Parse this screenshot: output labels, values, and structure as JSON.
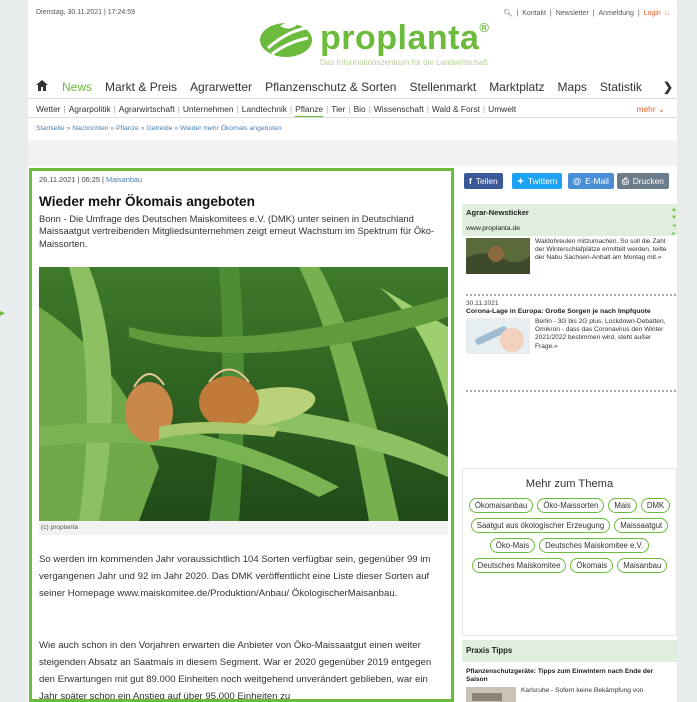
{
  "topbar": {
    "datetime": "Dienstag, 30.11.2021 | 17:24:59",
    "search_icon": "search-icon",
    "links": [
      "Kontakt",
      "Newsletter",
      "Anmeldung"
    ],
    "separator": "|",
    "login": "Login"
  },
  "logo": {
    "name": "proplanta",
    "reg": "®",
    "tagline": "Das Informationszentrum für die Landwirtschaft"
  },
  "mainnav": {
    "items": [
      "News",
      "Markt & Preis",
      "Agrarwetter",
      "Pflanzenschutz & Sorten",
      "Stellenmarkt",
      "Marktplatz",
      "Maps",
      "Statistik"
    ],
    "next": "❯"
  },
  "subnav": {
    "items": [
      "Wetter",
      "Agrarpolitik",
      "Agrarwirtschaft",
      "Unternehmen",
      "Landtechnik",
      "Pflanze",
      "Tier",
      "Bio",
      "Wissenschaft",
      "Wald & Forst",
      "Umwelt"
    ],
    "more": "mehr"
  },
  "breadcrumb": "Startseite » Nachrichten » Pflanze » Getreide » Wieder mehr Ökomais angeboten",
  "article": {
    "date": "26.11.2021 | 06:25 |",
    "category": "Maisanbau",
    "title": "Wieder mehr Ökomais angeboten",
    "lead": "Bonn - Die Umfrage des Deutschen Maiskomitees e.V. (DMK) unter seinen in Deutschland Maissaatgut vertreibenden Mitgliedsunternehmen zeigt erneut Wachstum im Spektrum für Öko-Maissorten.",
    "caption": "(c) proplanta",
    "paragraph1": "So werden im kommenden Jahr voraussichtlich 104 Sorten verfügbar sein, gegenüber 99 im vergangenen Jahr und 92 im Jahr 2020. Das DMK veröffentlicht eine Liste dieser Sorten auf seiner Homepage www.maiskomitee.de/Produktion/Anbau/ ÖkologischerMaisanbau.",
    "paragraph2": "Wie auch schon in den Vorjahren erwarten die Anbieter von Öko-Maissaatgut einen weiter steigenden Absatz an Saatmais in diesem Segment. War er 2020 gegenüber 2019 entgegen den Erwartungen mit gut 89.000 Einheiten noch weitgehend unverändert geblieben, war ein Jahr später schon ein Anstieg auf über 95.000 Einheiten zu"
  },
  "share": {
    "facebook": "Teilen",
    "twitter": "Twittern",
    "email": "E-Mail",
    "print": "Drucken"
  },
  "ticker": {
    "title": "Agrar-Newsticker",
    "url": "www.proplanta.de",
    "item1_text": "Waldohreulen mitzumachen. So soll die Zahl der Winterschlafplätze ermittelt werden, teilte der Nabu Sachsen-Anhalt am Montag mit.»",
    "item2_date": "30.11.2021",
    "item2_title": "Corona-Lage in Europa: Große Sorgen je nach Impfquote",
    "item2_text": "Berlin - 3G bis 2G plus, Lockdown-Debatten, Omikron - dass das Coronavirus den Winter 2021/2022 bestimmen wird, steht außer Frage.»"
  },
  "mehr": {
    "title": "Mehr zum Thema",
    "tags": [
      "Ökomaisanbau",
      "Öko-Maissorten",
      "Mais",
      "DMK",
      "Saatgut aus ökologischer Erzeugung",
      "Maissaatgut",
      "Öko-Mais",
      "Deutsches Maiskomitee e.V.",
      "Deutsches Maiskomitee",
      "Ökomais",
      "Maisanbau"
    ]
  },
  "praxis": {
    "title": "Praxis Tipps",
    "item_title": "Pflanzenschutzgeräte: Tipps zum Einwintern nach Ende der Saison",
    "item_text": "Karlsruhe - Sofern keine Bekämpfung von"
  },
  "colors": {
    "brand_green": "#6dbb3c",
    "link_blue": "#4a7fb5",
    "accent_orange": "#e8622c"
  }
}
